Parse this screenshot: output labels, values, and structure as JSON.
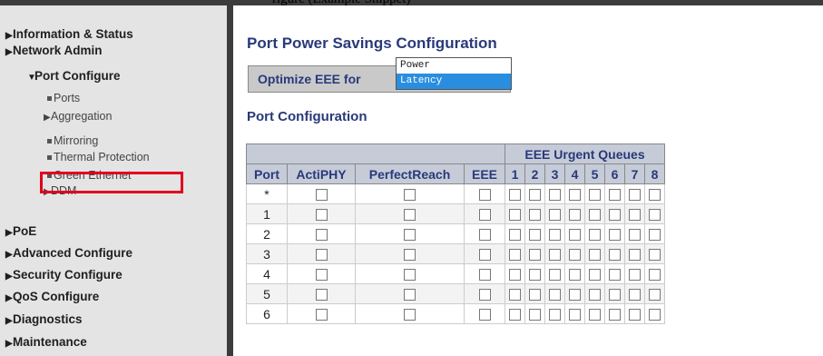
{
  "window": {
    "title_fragment": "rigure (Example Snippet)"
  },
  "sidebar": {
    "items": [
      {
        "label": "Information & Status"
      },
      {
        "label": "Network Admin"
      },
      {
        "label": "Port Configure"
      },
      {
        "label": "PoE"
      },
      {
        "label": "Advanced Configure"
      },
      {
        "label": "Security Configure"
      },
      {
        "label": "QoS Configure"
      },
      {
        "label": "Diagnostics"
      },
      {
        "label": "Maintenance"
      }
    ],
    "port_configure_sub": [
      {
        "label": "Ports"
      },
      {
        "label": "Aggregation"
      },
      {
        "label": "Mirroring"
      },
      {
        "label": "Thermal Protection"
      },
      {
        "label": "Green Ethernet"
      },
      {
        "label": "DDM"
      }
    ]
  },
  "main": {
    "title": "Port Power Savings Configuration",
    "optimize_label": "Optimize EEE for",
    "dropdown_options": [
      "Power",
      "Latency"
    ],
    "selected_option": "Latency",
    "section_title": "Port Configuration",
    "table": {
      "group_header": "EEE Urgent Queues",
      "headers": [
        "Port",
        "ActiPHY",
        "PerfectReach",
        "EEE",
        "1",
        "2",
        "3",
        "4",
        "5",
        "6",
        "7",
        "8"
      ],
      "rows": [
        "*",
        "1",
        "2",
        "3",
        "4",
        "5",
        "6"
      ]
    }
  },
  "colors": {
    "heading": "#29397a",
    "highlight_box": "#e0001b",
    "selection": "#2a8ee0"
  }
}
